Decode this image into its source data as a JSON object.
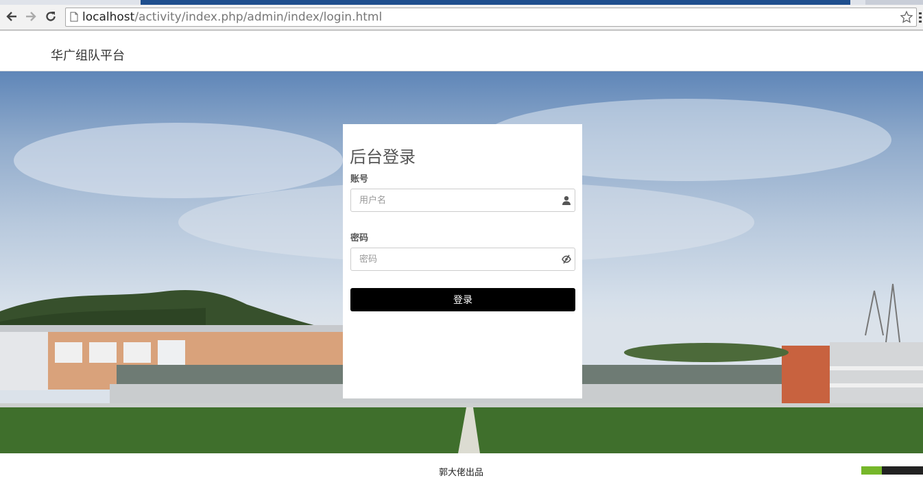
{
  "browser": {
    "url_host": "localhost",
    "url_path": "/activity/index.php/admin/index/login.html"
  },
  "header": {
    "brand": "华广组队平台"
  },
  "login": {
    "title": "后台登录",
    "account_label": "账号",
    "username_placeholder": "用户名",
    "password_label": "密码",
    "password_placeholder": "密码",
    "submit_label": "登录"
  },
  "footer": {
    "credit": "郭大佬出品"
  },
  "colors": {
    "button": "#000000",
    "badge_green": "#76b72a"
  }
}
